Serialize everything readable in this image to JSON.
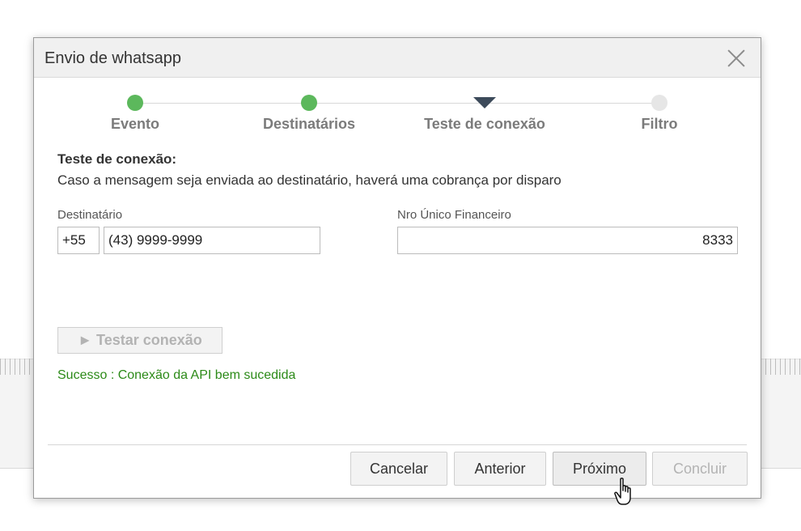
{
  "dialog": {
    "title": "Envio de whatsapp"
  },
  "steps": [
    {
      "label": "Evento",
      "state": "done"
    },
    {
      "label": "Destinatários",
      "state": "done"
    },
    {
      "label": "Teste de conexão",
      "state": "current"
    },
    {
      "label": "Filtro",
      "state": "todo"
    }
  ],
  "section": {
    "title": "Teste de conexão:",
    "description": "Caso a mensagem seja enviada ao destinatário, haverá uma cobrança por disparo"
  },
  "fields": {
    "destinatario_label": "Destinatário",
    "country_code": "+55",
    "phone": "(43) 9999-9999",
    "nro_label": "Nro Único Financeiro",
    "nro_value": "8333"
  },
  "test": {
    "button_label": "► Testar conexão",
    "result": "Sucesso : Conexão da API bem sucedida"
  },
  "footer": {
    "cancel": "Cancelar",
    "previous": "Anterior",
    "next": "Próximo",
    "finish": "Concluir"
  },
  "colors": {
    "done": "#5cb85c",
    "current": "#3c4a5a",
    "todo": "#e6e6e6",
    "success": "#2c8a18"
  },
  "icons": {
    "close": "close-icon",
    "cursor": "hand-pointer-icon"
  }
}
